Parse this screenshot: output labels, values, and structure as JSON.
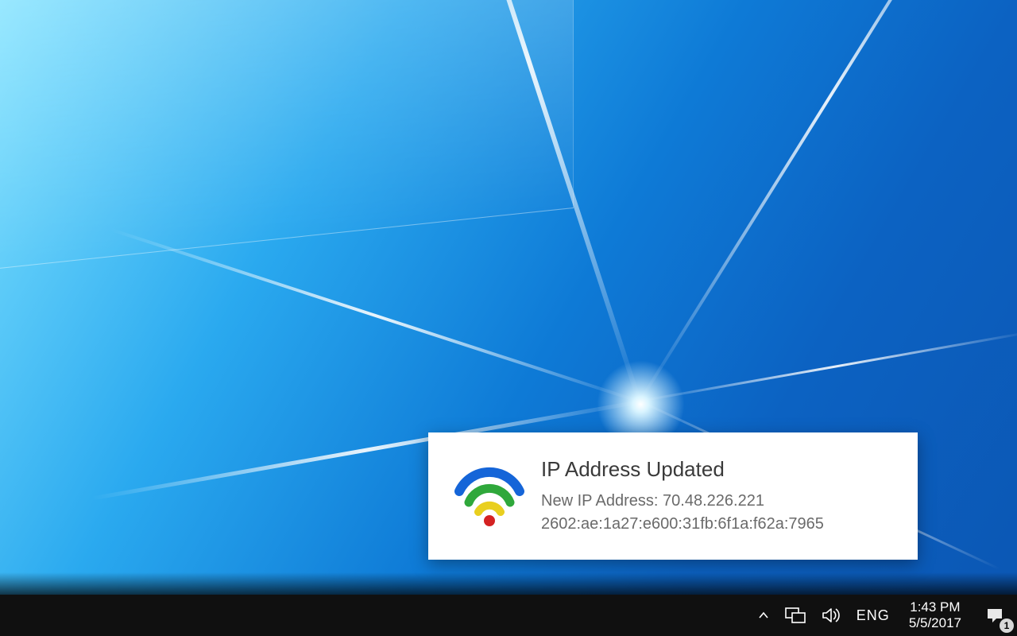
{
  "notification": {
    "title": "IP Address Updated",
    "line1": "New IP Address: 70.48.226.221",
    "line2": "2602:ae:1a27:e600:31fb:6f1a:f62a:7965",
    "icon": "wifi-icon"
  },
  "taskbar": {
    "language": "ENG",
    "time": "1:43 PM",
    "date": "5/5/2017",
    "action_center_badge": "1"
  }
}
